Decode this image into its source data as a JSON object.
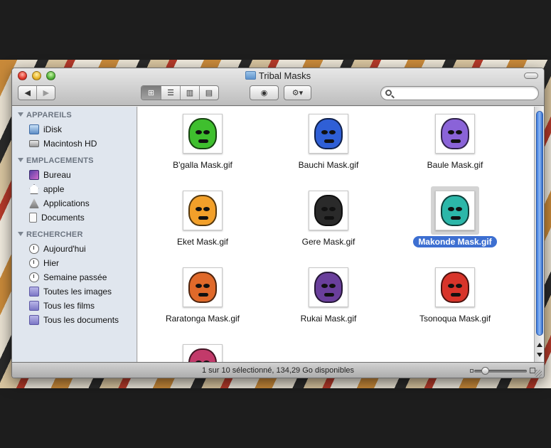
{
  "window": {
    "title": "Tribal Masks"
  },
  "toolbar": {
    "back_glyph": "◀",
    "forward_glyph": "▶",
    "view_icons": [
      "icon-view-icon",
      "list-view-icon",
      "column-view-icon",
      "coverflow-view-icon"
    ],
    "view_glyphs": [
      "⊞",
      "☰",
      "▥",
      "▤"
    ],
    "quicklook_glyph": "◉",
    "action_glyph": "⚙▾",
    "search": {
      "value": "",
      "placeholder": ""
    }
  },
  "sidebar": {
    "sections": [
      {
        "title": "APPAREILS",
        "items": [
          {
            "label": "iDisk",
            "icon": "idisk-icon"
          },
          {
            "label": "Macintosh HD",
            "icon": "hard-drive-icon"
          }
        ]
      },
      {
        "title": "EMPLACEMENTS",
        "items": [
          {
            "label": "Bureau",
            "icon": "desktop-icon"
          },
          {
            "label": "apple",
            "icon": "home-icon"
          },
          {
            "label": "Applications",
            "icon": "applications-icon"
          },
          {
            "label": "Documents",
            "icon": "documents-icon"
          }
        ]
      },
      {
        "title": "RECHERCHER",
        "items": [
          {
            "label": "Aujourd'hui",
            "icon": "clock-icon"
          },
          {
            "label": "Hier",
            "icon": "clock-icon"
          },
          {
            "label": "Semaine passée",
            "icon": "clock-icon"
          },
          {
            "label": "Toutes les images",
            "icon": "smart-folder-icon"
          },
          {
            "label": "Tous les films",
            "icon": "smart-folder-icon"
          },
          {
            "label": "Tous les documents",
            "icon": "smart-folder-icon"
          }
        ]
      }
    ]
  },
  "files": [
    {
      "name": "B'galla Mask.gif",
      "color": "#3fbf2e",
      "selected": false
    },
    {
      "name": "Bauchi Mask.gif",
      "color": "#2f5fd6",
      "selected": false
    },
    {
      "name": "Baule Mask.gif",
      "color": "#8a63d8",
      "selected": false
    },
    {
      "name": "Eket Mask.gif",
      "color": "#f2a02a",
      "selected": false
    },
    {
      "name": "Gere Mask.gif",
      "color": "#2a2a2a",
      "selected": false
    },
    {
      "name": "Makonde Mask.gif",
      "color": "#2cb7a9",
      "selected": true
    },
    {
      "name": "Raratonga Mask.gif",
      "color": "#e0692a",
      "selected": false
    },
    {
      "name": "Rukai Mask.gif",
      "color": "#6a3f9c",
      "selected": false
    },
    {
      "name": "Tsonoqua Mask.gif",
      "color": "#d8342a",
      "selected": false
    },
    {
      "name": "",
      "color": "#c23a6a",
      "selected": false
    }
  ],
  "status": {
    "text": "1 sur 10 sélectionné, 134,29 Go disponibles"
  },
  "zoom_slider": {
    "value": 0.2
  }
}
